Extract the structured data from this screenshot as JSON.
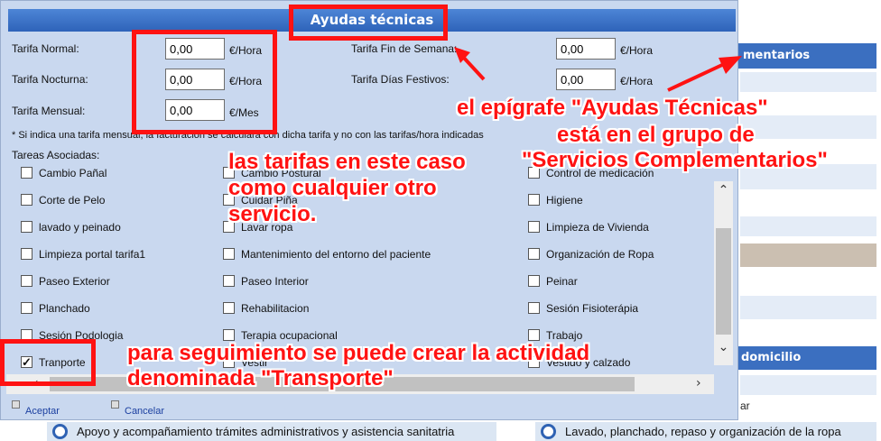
{
  "dialog": {
    "title": "Ayudas técnicas",
    "rates": {
      "normal": {
        "label": "Tarifa Normal:",
        "value": "0,00",
        "unit": "€/Hora"
      },
      "nocturna": {
        "label": "Tarifa Nocturna:",
        "value": "0,00",
        "unit": "€/Hora"
      },
      "mensual": {
        "label": "Tarifa Mensual:",
        "value": "0,00",
        "unit": "€/Mes"
      },
      "fin_semana": {
        "label": "Tarifa Fin de Semana:",
        "value": "0,00",
        "unit": "€/Hora"
      },
      "festivos": {
        "label": "Tarifa Días Festivos:",
        "value": "0,00",
        "unit": "€/Hora"
      }
    },
    "note": "* Si indica una tarifa mensual, la facturación se calculará con dicha tarifa y no con las tarifas/hora indicadas",
    "tasks_label": "Tareas Asociadas:",
    "tasks": [
      [
        "Cambio Pañal",
        "Cambio Postural",
        "Control de medicación"
      ],
      [
        "Corte de Pelo",
        "Cuidar Piña",
        "Higiene"
      ],
      [
        "lavado y peinado",
        "Lavar ropa",
        "Limpieza de Vivienda"
      ],
      [
        "Limpieza portal tarifa1",
        "Mantenimiento del entorno del paciente",
        "Organización de Ropa"
      ],
      [
        "Paseo Exterior",
        "Paseo Interior",
        "Peinar"
      ],
      [
        "Planchado",
        "Rehabilitacion",
        "Sesión Fisioterápia"
      ],
      [
        "Sesión Podologia",
        "Terapia ocupacional",
        "Trabajo"
      ],
      [
        "Tranporte",
        "Vestir",
        "Vestido y calzado"
      ]
    ],
    "checked_task": "Tranporte",
    "accept_label": "Aceptar",
    "cancel_label": "Cancelar"
  },
  "background": {
    "header1": "mentarios",
    "header2": "domicilio",
    "partial_text": "ar",
    "item_left": "Apoyo y acompañamiento trámites administrativos y asistencia sanitatria",
    "item_right": "Lavado, planchado, repaso y organización de la ropa"
  },
  "annotations": {
    "epigrafe_line1": "el epígrafe \"Ayudas Técnicas\"",
    "epigrafe_line2": "está en el grupo de",
    "epigrafe_line3": "\"Servicios Complementarios\"",
    "tarifas_line1": "las tarifas en este caso",
    "tarifas_line2": "como cualquier otro",
    "tarifas_line3": "servicio.",
    "transporte_line1": "para seguimiento se puede crear la actividad",
    "transporte_line2": "denominada \"Transporte\""
  },
  "colors": {
    "annotation": "#ff1212",
    "title_bar": "#3b6fc0",
    "dialog_bg": "#c9d8ef"
  }
}
